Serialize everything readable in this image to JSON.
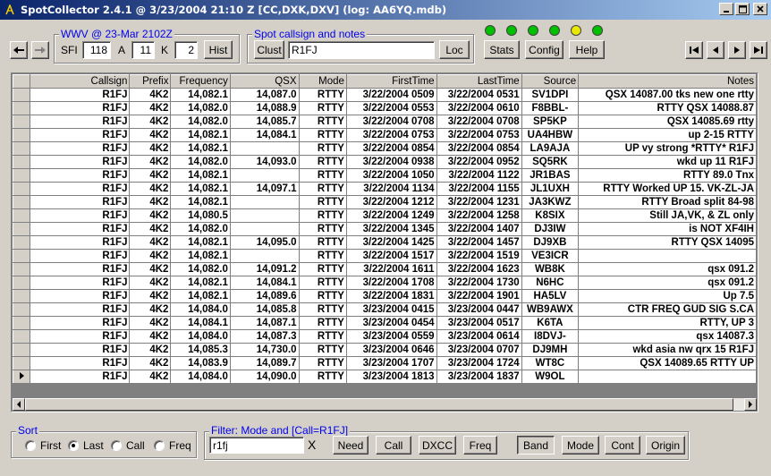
{
  "window": {
    "title": "SpotCollector 2.4.1 @ 3/23/2004 21:10 Z [CC,DXK,DXV] (log: AA6YQ.mdb)"
  },
  "wwv": {
    "title": "WWV @ 23-Mar 2102Z",
    "sfi_label": "SFI",
    "sfi": "118",
    "a_label": "A",
    "a": "11",
    "k_label": "K",
    "k": "2",
    "hist_label": "Hist"
  },
  "spot": {
    "title": "Spot callsign and notes",
    "clust_label": "Clust",
    "value": "R1FJ",
    "loc_label": "Loc"
  },
  "toolbar": {
    "stats_label": "Stats",
    "config_label": "Config",
    "help_label": "Help"
  },
  "leds": [
    "#00c000",
    "#00c000",
    "#00c000",
    "#00c000",
    "#e8e800",
    "#00c000"
  ],
  "grid": {
    "columns": [
      "Callsign",
      "Prefix",
      "Frequency",
      "QSX",
      "Mode",
      "FirstTime",
      "LastTime",
      "Source",
      "Notes"
    ],
    "rows": [
      [
        "R1FJ",
        "4K2",
        "14,082.1",
        "14,087.0",
        "RTTY",
        "3/22/2004 0509",
        "3/22/2004 0531",
        "SV1DPI",
        "QSX 14087.00 tks new one rtty"
      ],
      [
        "R1FJ",
        "4K2",
        "14,082.0",
        "14,088.9",
        "RTTY",
        "3/22/2004 0553",
        "3/22/2004 0610",
        "F8BBL-",
        "RTTY QSX 14088.87"
      ],
      [
        "R1FJ",
        "4K2",
        "14,082.0",
        "14,085.7",
        "RTTY",
        "3/22/2004 0708",
        "3/22/2004 0708",
        "SP5KP",
        "QSX 14085.69 rtty"
      ],
      [
        "R1FJ",
        "4K2",
        "14,082.1",
        "14,084.1",
        "RTTY",
        "3/22/2004 0753",
        "3/22/2004 0753",
        "UA4HBW",
        "up 2-15 RTTY"
      ],
      [
        "R1FJ",
        "4K2",
        "14,082.1",
        "",
        "RTTY",
        "3/22/2004 0854",
        "3/22/2004 0854",
        "LA9AJA",
        "UP vy strong  *RTTY*     R1FJ"
      ],
      [
        "R1FJ",
        "4K2",
        "14,082.0",
        "14,093.0",
        "RTTY",
        "3/22/2004 0938",
        "3/22/2004 0952",
        "SQ5RK",
        "wkd up 11          R1FJ"
      ],
      [
        "R1FJ",
        "4K2",
        "14,082.1",
        "",
        "RTTY",
        "3/22/2004 1050",
        "3/22/2004 1122",
        "JR1BAS",
        "RTTY 89.0 Tnx"
      ],
      [
        "R1FJ",
        "4K2",
        "14,082.1",
        "14,097.1",
        "RTTY",
        "3/22/2004 1134",
        "3/22/2004 1155",
        "JL1UXH",
        "RTTY Worked UP 15. VK-ZL-JA"
      ],
      [
        "R1FJ",
        "4K2",
        "14,082.1",
        "",
        "RTTY",
        "3/22/2004 1212",
        "3/22/2004 1231",
        "JA3KWZ",
        "RTTY Broad split 84-98"
      ],
      [
        "R1FJ",
        "4K2",
        "14,080.5",
        "",
        "RTTY",
        "3/22/2004 1249",
        "3/22/2004 1258",
        "K8SIX",
        "Still JA,VK, & ZL only"
      ],
      [
        "R1FJ",
        "4K2",
        "14,082.0",
        "",
        "RTTY",
        "3/22/2004 1345",
        "3/22/2004 1407",
        "DJ3IW",
        "is NOT XF4IH"
      ],
      [
        "R1FJ",
        "4K2",
        "14,082.1",
        "14,095.0",
        "RTTY",
        "3/22/2004 1425",
        "3/22/2004 1457",
        "DJ9XB",
        "RTTY QSX 14095"
      ],
      [
        "R1FJ",
        "4K2",
        "14,082.1",
        "",
        "RTTY",
        "3/22/2004 1517",
        "3/22/2004 1519",
        "VE3ICR",
        ""
      ],
      [
        "R1FJ",
        "4K2",
        "14,082.0",
        "14,091.2",
        "RTTY",
        "3/22/2004 1611",
        "3/22/2004 1623",
        "WB8K",
        "qsx 091.2"
      ],
      [
        "R1FJ",
        "4K2",
        "14,082.1",
        "14,084.1",
        "RTTY",
        "3/22/2004 1708",
        "3/22/2004 1730",
        "N6HC",
        "qsx 091.2"
      ],
      [
        "R1FJ",
        "4K2",
        "14,082.1",
        "14,089.6",
        "RTTY",
        "3/22/2004 1831",
        "3/22/2004 1901",
        "HA5LV",
        "Up 7.5"
      ],
      [
        "R1FJ",
        "4K2",
        "14,084.0",
        "14,085.8",
        "RTTY",
        "3/23/2004 0415",
        "3/23/2004 0447",
        "WB9AWX",
        "CTR FREQ  GUD SIG S.CA"
      ],
      [
        "R1FJ",
        "4K2",
        "14,084.1",
        "14,087.1",
        "RTTY",
        "3/23/2004 0454",
        "3/23/2004 0517",
        "K6TA",
        "RTTY, UP 3"
      ],
      [
        "R1FJ",
        "4K2",
        "14,084.0",
        "14,087.3",
        "RTTY",
        "3/23/2004 0559",
        "3/23/2004 0614",
        "I8DVJ-",
        "qsx 14087.3"
      ],
      [
        "R1FJ",
        "4K2",
        "14,085.3",
        "14,730.0",
        "RTTY",
        "3/23/2004 0646",
        "3/23/2004 0707",
        "DJ9MH",
        "wkd asia nw qrx 15       R1FJ"
      ],
      [
        "R1FJ",
        "4K2",
        "14,083.9",
        "14,089.7",
        "RTTY",
        "3/23/2004 1707",
        "3/23/2004 1724",
        "WT8C",
        "QSX 14089.65 RTTY UP"
      ],
      [
        "R1FJ",
        "4K2",
        "14,084.0",
        "14,090.0",
        "RTTY",
        "3/23/2004 1813",
        "3/23/2004 1837",
        "W9OL",
        ""
      ]
    ]
  },
  "sort": {
    "title": "Sort",
    "options": [
      "First",
      "Last",
      "Call",
      "Freq"
    ],
    "selected": "Last"
  },
  "filter": {
    "title": "Filter: Mode and [Call=R1FJ]",
    "value": "r1fj",
    "clear_label": "X",
    "buttons": [
      "Need",
      "Call",
      "DXCC",
      "Freq",
      "Band",
      "Mode",
      "Cont",
      "Origin"
    ],
    "active": "Band"
  }
}
